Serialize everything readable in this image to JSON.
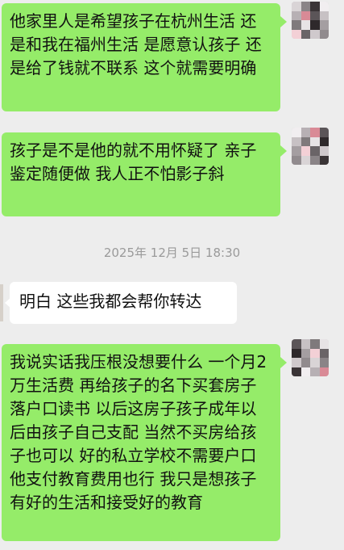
{
  "conversation": {
    "timestamp": "2025年 12月 5日 18:30",
    "messages": [
      {
        "sender": "me",
        "text": "他家里人是希望孩子在杭州生活 还是和我在福州生活 是愿意认孩子 还是给了钱就不联系 这个就需要明确"
      },
      {
        "sender": "me",
        "text": "孩子是不是他的就不用怀疑了 亲子鉴定随便做 我人正不怕影子斜"
      },
      {
        "sender": "other",
        "text": "明白 这些我都会帮你转达"
      },
      {
        "sender": "me",
        "text": "我说实话我压根没想要什么 一个月2万生活费 再给孩子的名下买套房子落户口读书 以后这房子孩子成年以后由孩子自己支配 当然不买房给孩子也可以 好的私立学校不需要户口 他支付教育费用也行 我只是想孩子有好的生活和接受好的教育"
      }
    ]
  },
  "colors": {
    "sent_bubble": "#95ec69",
    "received_bubble": "#ffffff",
    "background": "#ededed",
    "timestamp_text": "#9a9a9a"
  },
  "icons": {
    "self_avatar": "pixelated-avatar-icon"
  }
}
